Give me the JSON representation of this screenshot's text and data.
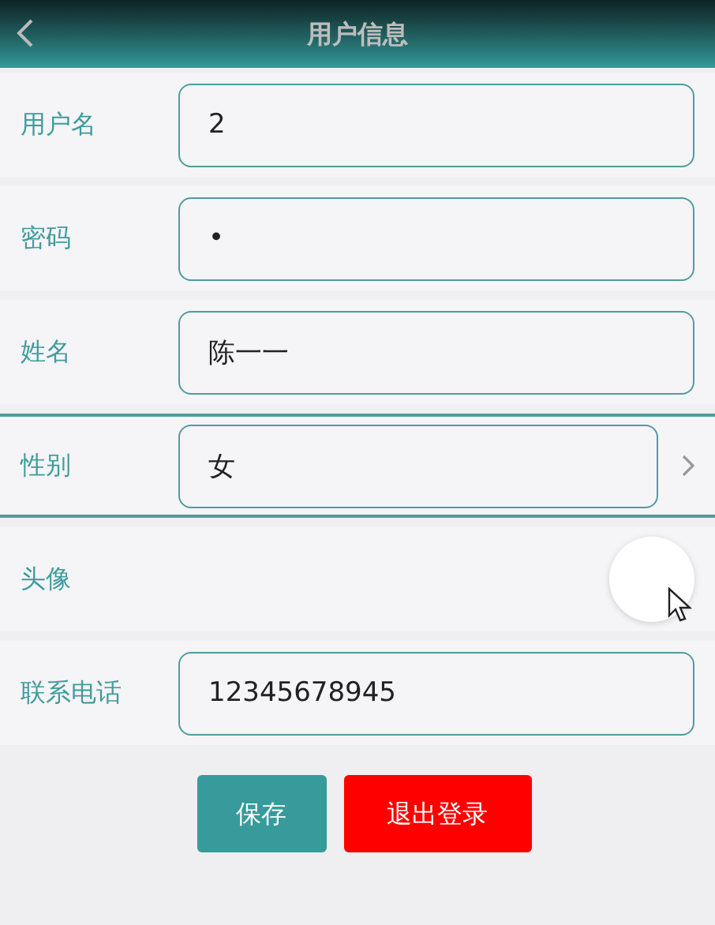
{
  "header": {
    "title": "用户信息"
  },
  "fields": [
    {
      "kind": "input",
      "label": "用户名",
      "value": "2"
    },
    {
      "kind": "input",
      "label": "密码",
      "value": "•"
    },
    {
      "kind": "input",
      "label": "姓名",
      "value": "陈一一"
    },
    {
      "kind": "select",
      "label": "性别",
      "value": "女"
    },
    {
      "kind": "avatar",
      "label": "头像"
    },
    {
      "kind": "input",
      "label": "联系电话",
      "value": "12345678945"
    }
  ],
  "buttons": [
    {
      "kind": "primary",
      "label": "保存"
    },
    {
      "kind": "danger",
      "label": "退出登录"
    }
  ]
}
